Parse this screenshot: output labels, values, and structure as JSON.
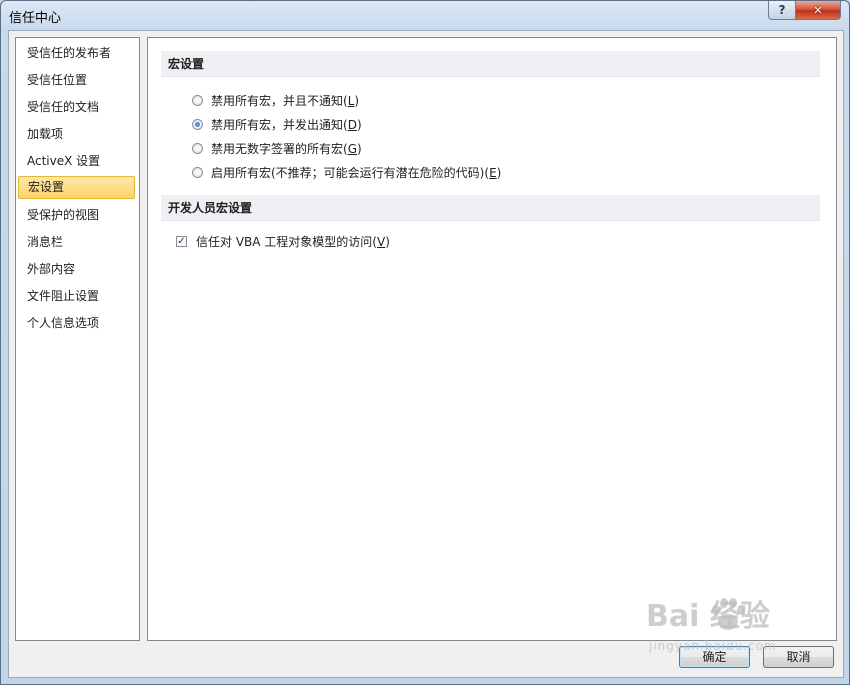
{
  "window": {
    "title": "信任中心",
    "help_icon": "?",
    "close_icon": "✕"
  },
  "nav": {
    "items": [
      {
        "label": "受信任的发布者",
        "selected": false
      },
      {
        "label": "受信任位置",
        "selected": false
      },
      {
        "label": "受信任的文档",
        "selected": false
      },
      {
        "label": "加载项",
        "selected": false
      },
      {
        "label": "ActiveX 设置",
        "selected": false
      },
      {
        "label": "宏设置",
        "selected": true
      },
      {
        "label": "受保护的视图",
        "selected": false
      },
      {
        "label": "消息栏",
        "selected": false
      },
      {
        "label": "外部内容",
        "selected": false
      },
      {
        "label": "文件阻止设置",
        "selected": false
      },
      {
        "label": "个人信息选项",
        "selected": false
      }
    ]
  },
  "macro_settings": {
    "header": "宏设置",
    "options": [
      {
        "text": "禁用所有宏，并且不通知(",
        "key": "L",
        "tail": ")",
        "checked": false
      },
      {
        "text": "禁用所有宏，并发出通知(",
        "key": "D",
        "tail": ")",
        "checked": true
      },
      {
        "text": "禁用无数字签署的所有宏(",
        "key": "G",
        "tail": ")",
        "checked": false
      },
      {
        "text": "启用所有宏(不推荐；可能会运行有潜在危险的代码)(",
        "key": "E",
        "tail": ")",
        "checked": false
      }
    ]
  },
  "developer": {
    "header": "开发人员宏设置",
    "checkbox": {
      "text": "信任对 VBA 工程对象模型的访问(",
      "key": "V",
      "tail": ")",
      "checked": true
    }
  },
  "buttons": {
    "ok": "确定",
    "cancel": "取消"
  },
  "watermark": {
    "text": "Bai  经验",
    "sub": "jingyan.baidu.com"
  }
}
